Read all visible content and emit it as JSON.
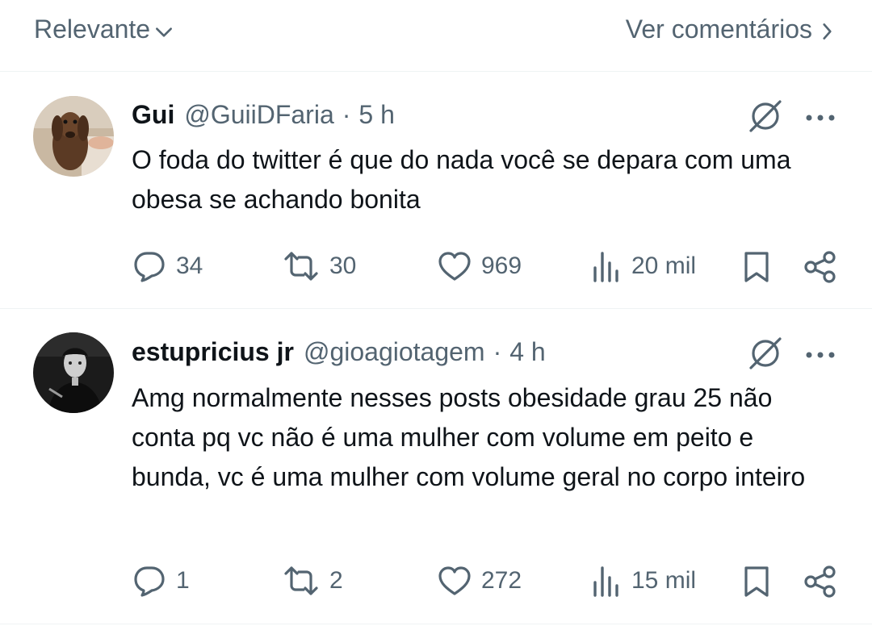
{
  "header": {
    "sort_label": "Relevante",
    "see_comments_label": "Ver comentários"
  },
  "tweets": [
    {
      "name": "Gui",
      "handle": "@GuiiDFaria",
      "separator": "·",
      "time": "5 h",
      "text": "O foda do twitter é que do nada você se depara com uma obesa se achando bonita",
      "replies": "34",
      "retweets": "30",
      "likes": "969",
      "views": "20 mil"
    },
    {
      "name": "estupricius jr",
      "handle": "@gioagiotagem",
      "separator": "·",
      "time": "4 h",
      "text": "Amg normalmente nesses posts obesidade grau 25 não conta pq vc não é uma mulher com volume em peito e bunda, vc é uma mulher com volume geral no corpo inteiro",
      "replies": "1",
      "retweets": "2",
      "likes": "272",
      "views": "15 mil"
    }
  ],
  "icons": {
    "reply": "reply-icon",
    "retweet": "retweet-icon",
    "like": "heart-icon",
    "views": "views-icon",
    "bookmark": "bookmark-icon",
    "share": "share-icon",
    "grok": "grok-icon",
    "more": "more-icon"
  },
  "colors": {
    "text": "#0f1419",
    "secondary": "#536471",
    "divider": "#eff3f4"
  }
}
